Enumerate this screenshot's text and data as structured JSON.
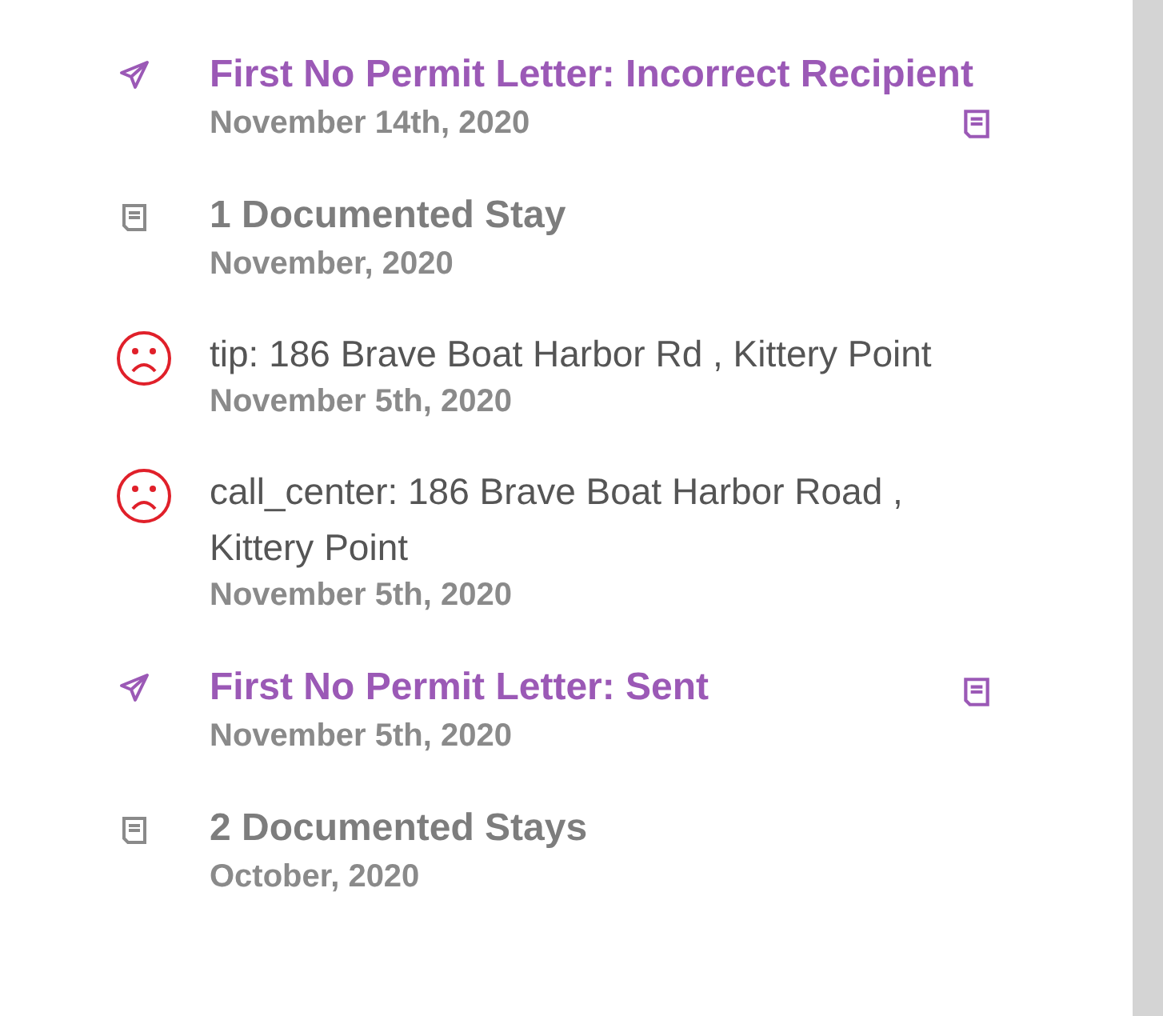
{
  "timeline": [
    {
      "kind": "letter",
      "title": "First No Permit Letter: Incorrect Recipient",
      "date": "November 14th, 2020",
      "has_attachment": true
    },
    {
      "kind": "stays",
      "title": "1 Documented Stay",
      "date": "November, 2020",
      "has_attachment": false
    },
    {
      "kind": "report",
      "title": "tip: 186 Brave Boat Harbor Rd , Kittery Point",
      "date": "November 5th, 2020",
      "has_attachment": false
    },
    {
      "kind": "report",
      "title": "call_center: 186 Brave Boat Harbor Road , Kittery Point",
      "date": "November 5th, 2020",
      "has_attachment": false
    },
    {
      "kind": "letter",
      "title": "First No Permit Letter: Sent",
      "date": "November 5th, 2020",
      "has_attachment": true
    },
    {
      "kind": "stays",
      "title": "2 Documented Stays",
      "date": "October, 2020",
      "has_attachment": false
    }
  ]
}
